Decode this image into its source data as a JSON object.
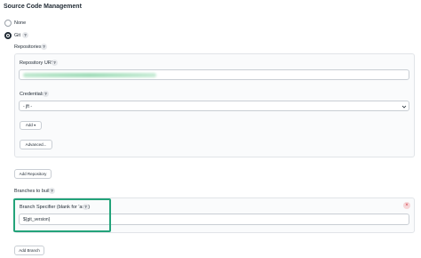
{
  "section": {
    "title": "Source Code Management"
  },
  "scm": {
    "none_label": "None",
    "git_label": "Git",
    "selected": "Git"
  },
  "repositories": {
    "label": "Repositories",
    "url_label": "Repository URL",
    "credentials_label": "Credentials",
    "credentials_value": "- jft -",
    "add_button": "Add",
    "advanced_button": "Advanced...",
    "add_repository_button": "Add Repository"
  },
  "branches": {
    "label": "Branches to build",
    "specifier_label": "Branch Specifier (blank for 'any')",
    "specifier_value": "${git_version}",
    "add_branch_button": "Add Branch"
  },
  "help_icon_text": "?",
  "colors": {
    "highlight": "#23a37a",
    "delete": "#d33b45"
  }
}
